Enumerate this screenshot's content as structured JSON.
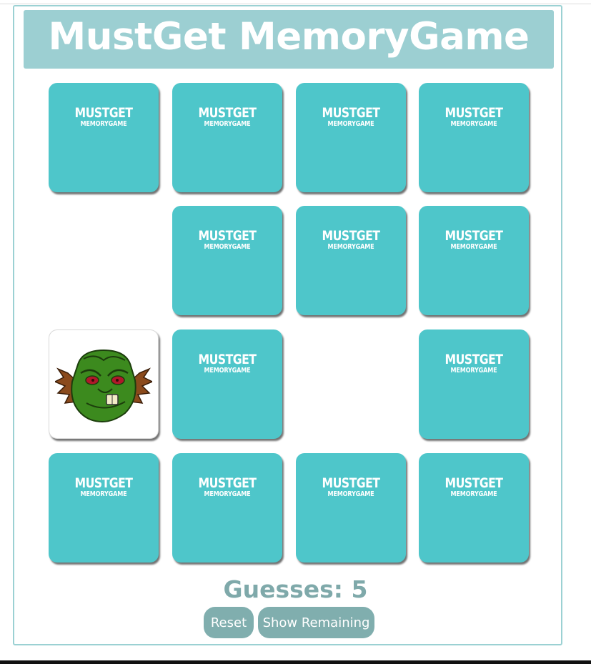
{
  "title": "MustGet MemoryGame",
  "card_back": {
    "line1": "MUSTGET",
    "line2": "MEMORYGAME"
  },
  "cards": [
    {
      "state": "back"
    },
    {
      "state": "back"
    },
    {
      "state": "back"
    },
    {
      "state": "back"
    },
    {
      "state": "matched"
    },
    {
      "state": "back"
    },
    {
      "state": "back"
    },
    {
      "state": "back"
    },
    {
      "state": "face",
      "icon": "green-goblin-face-icon"
    },
    {
      "state": "back"
    },
    {
      "state": "matched"
    },
    {
      "state": "back"
    },
    {
      "state": "back"
    },
    {
      "state": "back"
    },
    {
      "state": "back"
    },
    {
      "state": "back"
    }
  ],
  "guesses_label": "Guesses: 5",
  "buttons": {
    "reset": "Reset",
    "show_remaining": "Show Remaining"
  },
  "colors": {
    "title_bar": "#9ccfd2",
    "card_back": "#4ec6ca",
    "guess_text": "#7fa9aa",
    "button": "#80aeae",
    "frame_border": "#9bd1d3"
  }
}
